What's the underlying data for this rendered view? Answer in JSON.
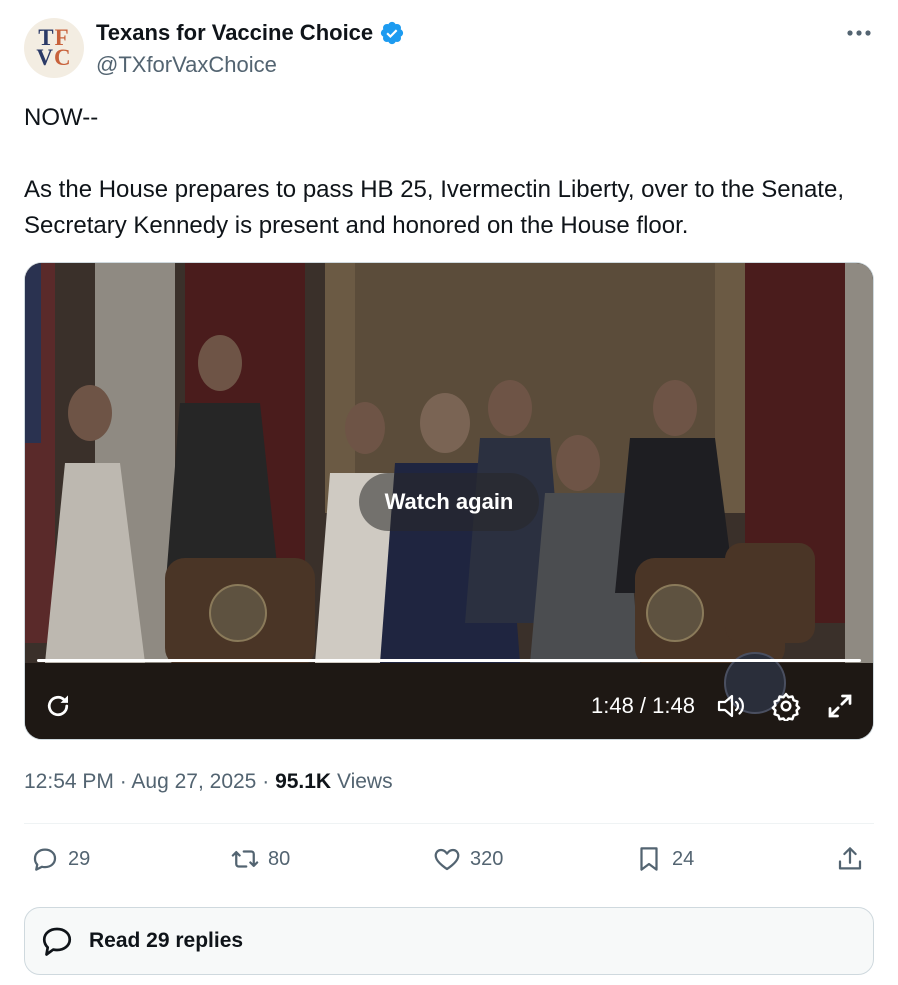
{
  "account": {
    "avatar_line1": "TF",
    "avatar_line2": "VC",
    "display_name": "Texans for Vaccine Choice",
    "handle": "@TXforVaxChoice",
    "verified": true
  },
  "tweet": {
    "line1": "NOW--",
    "line2": "As the House prepares to pass HB 25, Ivermectin Liberty, over to the Senate, Secretary Kennedy is present and honored on the House floor."
  },
  "video": {
    "overlay_label": "Watch again",
    "time": "1:48 / 1:48",
    "progress": 1.0
  },
  "meta": {
    "time": "12:54 PM",
    "date": "Aug 27, 2025",
    "views_count": "95.1K",
    "views_label": "Views",
    "sep": "·"
  },
  "actions": {
    "replies": "29",
    "reposts": "80",
    "likes": "320",
    "bookmarks": "24"
  },
  "read_replies": "Read 29 replies",
  "colors": {
    "verified": "#1d9bf0",
    "text_secondary": "#536471",
    "text_primary": "#0f1419"
  }
}
